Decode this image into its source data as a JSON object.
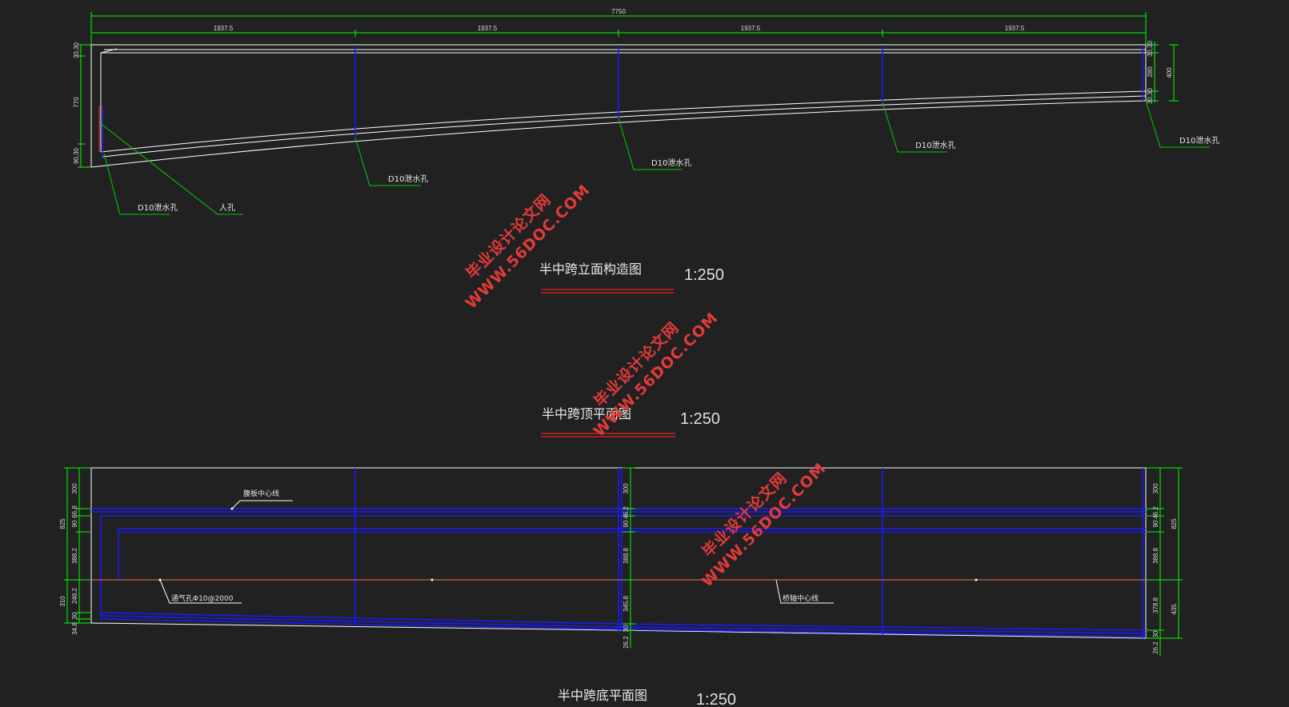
{
  "dims": {
    "total": "7750",
    "segments": [
      "1937.5",
      "1937.5",
      "1937.5",
      "1937.5"
    ],
    "elev_left": [
      "30,30",
      "770",
      "90,30"
    ],
    "elev_right": [
      "30,30",
      "280",
      "30,30",
      "400"
    ],
    "plan_left": [
      "300",
      "66,8",
      "90",
      "825",
      "388.2",
      "310",
      "248.2",
      "30",
      "34.8"
    ],
    "plan_mid": [
      "300",
      "46.2",
      "90",
      "388.8",
      "345.8",
      "30",
      "26.2"
    ],
    "plan_right": [
      "300",
      "46.2",
      "90",
      "825",
      "388.8",
      "378.8",
      "435",
      "30",
      "26.2"
    ]
  },
  "labels": {
    "drain_hole": "D10泄水孔",
    "manhole": "人孔",
    "curb_line": "腹板中心线",
    "vent_hole": "通气孔Φ10@2000",
    "bridge_axis": "桥轴中心线"
  },
  "titles": {
    "elevation": "半中跨立面构造图",
    "top_plan": "半中跨顶平面图",
    "bottom_plan": "半中跨底平面图",
    "scale": "1:250"
  },
  "watermark": {
    "cn": "毕业设计论文网",
    "en": "WWW.56DOC.COM"
  },
  "colors": {
    "background": "#212121",
    "outline": "#ffffff",
    "dimension": "#00ff00",
    "section": "#1a1aff",
    "leader": "#00cc00",
    "axis": "#ff6666",
    "title_underline": "#cc2222",
    "watermark": "#e23a3a"
  }
}
